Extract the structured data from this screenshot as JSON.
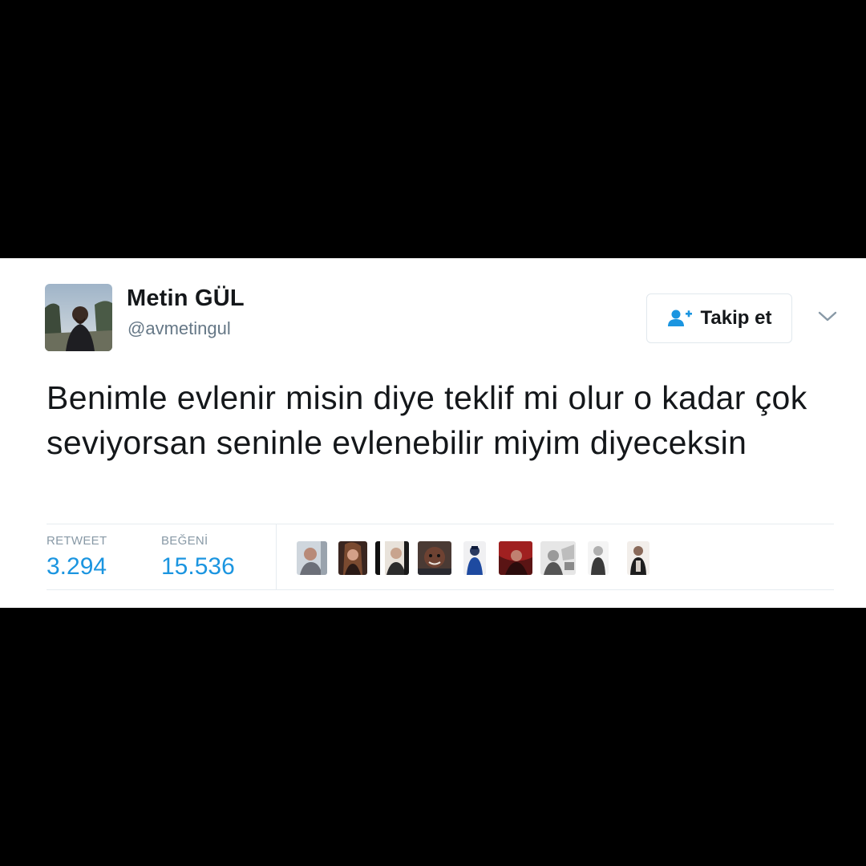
{
  "tweet": {
    "author": {
      "name": "Metin GÜL",
      "handle": "@avmetingul"
    },
    "follow_button": {
      "label": "Takip et",
      "icon": "add-user-icon"
    },
    "menu_icon": "chevron-down-icon",
    "text": "Benimle evlenir misin diye teklif mi olur o kadar çok seviyorsan seninle evlenebilir miyim diyeceksin",
    "stats": {
      "retweet_label": "RETWEET",
      "retweet_count": "3.294",
      "like_label": "BEĞENİ",
      "like_count": "15.536"
    },
    "liker_avatar_count": 9
  },
  "colors": {
    "background": "#000000",
    "card": "#ffffff",
    "text_primary": "#14171a",
    "text_secondary": "#657786",
    "accent": "#1b95e0",
    "border": "#e6ecf0"
  }
}
